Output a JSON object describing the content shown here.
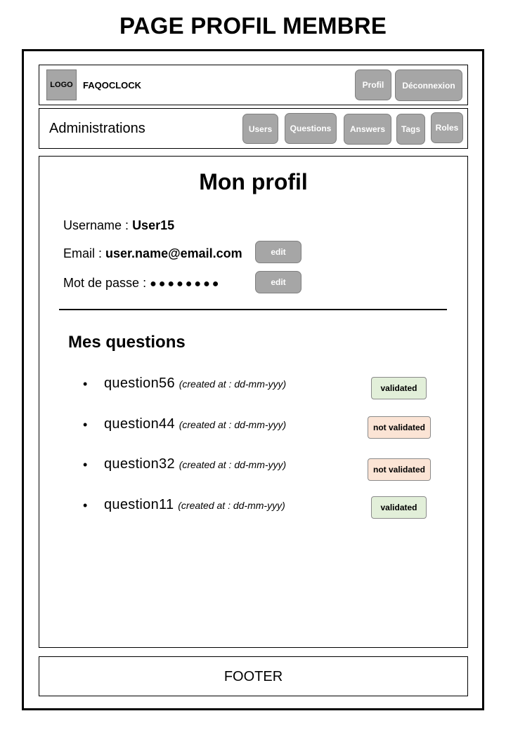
{
  "page_title": "PAGE PROFIL MEMBRE",
  "header": {
    "logo_label": "LOGO",
    "app_name": "FAQOCLOCK",
    "profil_label": "Profil",
    "logout_label": "Déconnexion"
  },
  "admin_bar": {
    "label": "Administrations",
    "buttons": [
      "Users",
      "Questions",
      "Answers",
      "Tags",
      "Roles"
    ]
  },
  "profile": {
    "title": "Mon profil",
    "username_label": "Username  :",
    "username_value": "User15",
    "email_label": "Email :",
    "email_value": "user.name@email.com",
    "password_label": "Mot de passe  :",
    "password_value": "●●●●●●●●",
    "edit_label": "edit"
  },
  "questions": {
    "title": "Mes questions",
    "items": [
      {
        "name": "question56",
        "date": "(created at : dd-mm-yyy)",
        "status": "validated"
      },
      {
        "name": "question44",
        "date": "(created at : dd-mm-yyy)",
        "status": "not validated"
      },
      {
        "name": "question32",
        "date": "(created at : dd-mm-yyy)",
        "status": "not validated"
      },
      {
        "name": "question11",
        "date": "(created at : dd-mm-yyy)",
        "status": "validated"
      }
    ]
  },
  "footer": {
    "label": "FOOTER"
  },
  "colors": {
    "button_gray": "#a6a6a6",
    "validated_bg": "#e2efd9",
    "not_validated_bg": "#fbe4d5"
  }
}
